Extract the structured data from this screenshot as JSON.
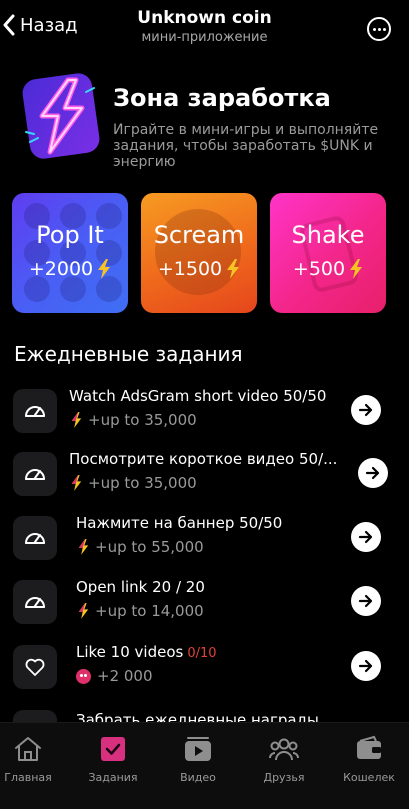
{
  "header": {
    "back_label": "Назад",
    "title": "Unknown coin",
    "subtitle": "мини-приложение"
  },
  "hero": {
    "title": "Зона заработка",
    "description": "Играйте в мини-игры и выполняйте задания, чтобы заработать $UNK и энергию"
  },
  "games": [
    {
      "name": "Pop It",
      "reward": "+2000"
    },
    {
      "name": "Scream",
      "reward": "+1500"
    },
    {
      "name": "Shake",
      "reward": "+500"
    }
  ],
  "daily": {
    "title": "Ежедневные задания",
    "tasks": [
      {
        "name": "Watch AdsGram short video 50/50",
        "reward": "+up to 35,000",
        "progress": "",
        "icon": "speedometer-icon"
      },
      {
        "name": "Посмотрите короткое видео 50/...",
        "reward": "+up to 35,000",
        "progress": "",
        "icon": "speedometer-icon"
      },
      {
        "name": "Нажмите на баннер 50/50",
        "reward": "+up to 55,000",
        "progress": "",
        "icon": "speedometer-icon"
      },
      {
        "name": "Open link 20 / 20",
        "reward": "+up to 14,000",
        "progress": "",
        "icon": "speedometer-icon"
      },
      {
        "name": "Like 10 videos",
        "reward": "+2 000",
        "progress": "0/10",
        "icon": "heart-icon"
      }
    ],
    "partial_task": "Забрать ежедневные награды"
  },
  "nav": [
    {
      "label": "Главная",
      "icon": "home-icon"
    },
    {
      "label": "Задания",
      "icon": "tasks-icon"
    },
    {
      "label": "Видео",
      "icon": "video-icon"
    },
    {
      "label": "Друзья",
      "icon": "friends-icon"
    },
    {
      "label": "Кошелек",
      "icon": "wallet-icon"
    }
  ],
  "colors": {
    "background": "#000000",
    "accent_pink": "#e0306a",
    "energy_yellow": "#f5c323",
    "progress_red": "#e0413a"
  }
}
